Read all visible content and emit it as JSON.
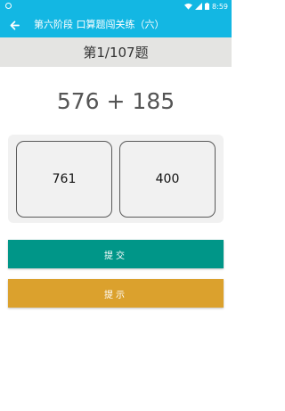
{
  "status_bar": {
    "time": "8:59",
    "icons": [
      "wifi-icon",
      "signal-icon",
      "battery-icon"
    ]
  },
  "app_bar": {
    "back_icon": "arrow-left-icon",
    "title": "第六阶段  口算题闯关练（六）"
  },
  "quiz": {
    "counter": "第1/107题",
    "expression": "576 + 185"
  },
  "options": [
    "761",
    "400"
  ],
  "buttons": {
    "submit": "提交",
    "hint": "提示"
  },
  "colors": {
    "primary": "#13b7e3",
    "submit": "#009688",
    "hint": "#dba12d",
    "header_bg": "#e4e4e2"
  }
}
